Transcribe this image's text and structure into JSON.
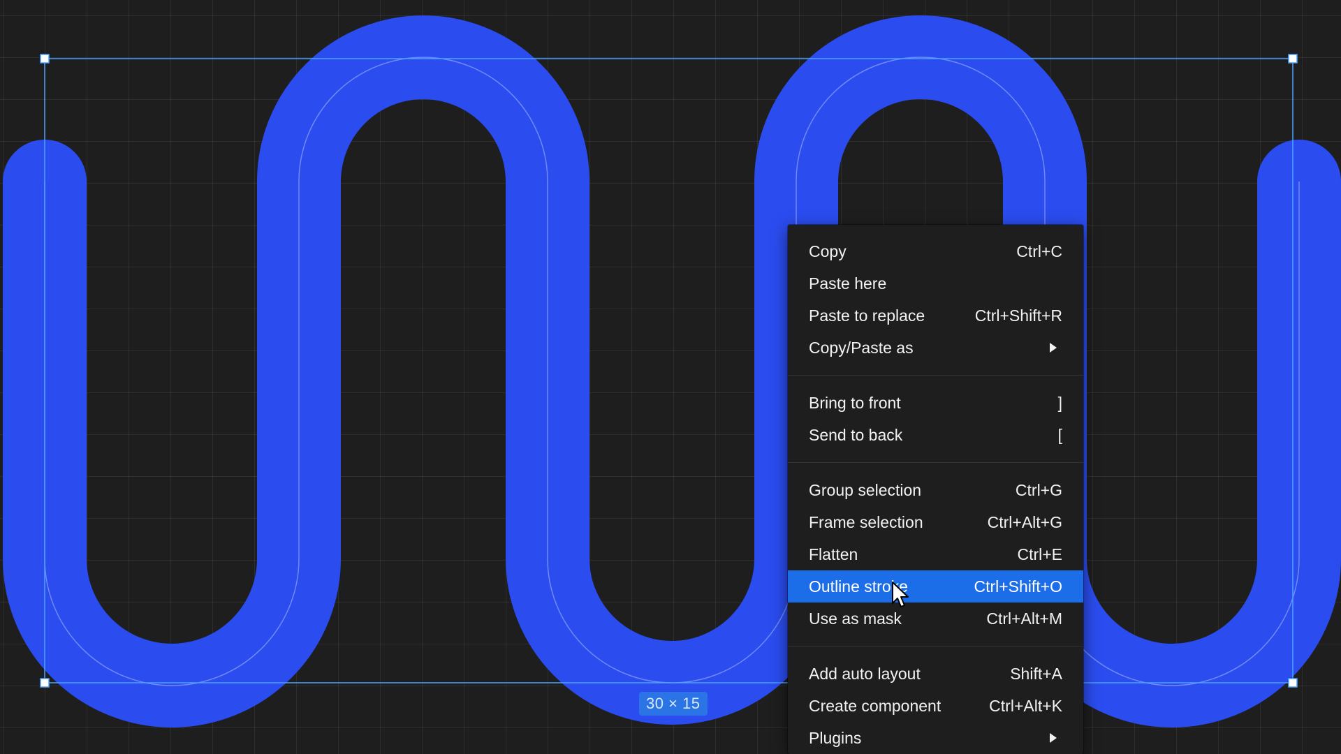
{
  "canvas": {
    "background": "#1e1e1e",
    "shape_color": "#2b4df0",
    "selection_color": "#4aa3ff",
    "size_label": "30 × 15"
  },
  "context_menu": {
    "groups": [
      {
        "items": [
          {
            "label": "Copy",
            "shortcut": "Ctrl+C"
          },
          {
            "label": "Paste here",
            "shortcut": ""
          },
          {
            "label": "Paste to replace",
            "shortcut": "Ctrl+Shift+R"
          },
          {
            "label": "Copy/Paste as",
            "shortcut": "",
            "submenu": true
          }
        ]
      },
      {
        "items": [
          {
            "label": "Bring to front",
            "shortcut": "]"
          },
          {
            "label": "Send to back",
            "shortcut": "["
          }
        ]
      },
      {
        "items": [
          {
            "label": "Group selection",
            "shortcut": "Ctrl+G"
          },
          {
            "label": "Frame selection",
            "shortcut": "Ctrl+Alt+G"
          },
          {
            "label": "Flatten",
            "shortcut": "Ctrl+E"
          },
          {
            "label": "Outline stroke",
            "shortcut": "Ctrl+Shift+O",
            "highlighted": true
          },
          {
            "label": "Use as mask",
            "shortcut": "Ctrl+Alt+M"
          }
        ]
      },
      {
        "items": [
          {
            "label": "Add auto layout",
            "shortcut": "Shift+A"
          },
          {
            "label": "Create component",
            "shortcut": "Ctrl+Alt+K"
          },
          {
            "label": "Plugins",
            "shortcut": "",
            "submenu": true
          }
        ]
      }
    ],
    "highlight_color": "#1b6ee8"
  }
}
